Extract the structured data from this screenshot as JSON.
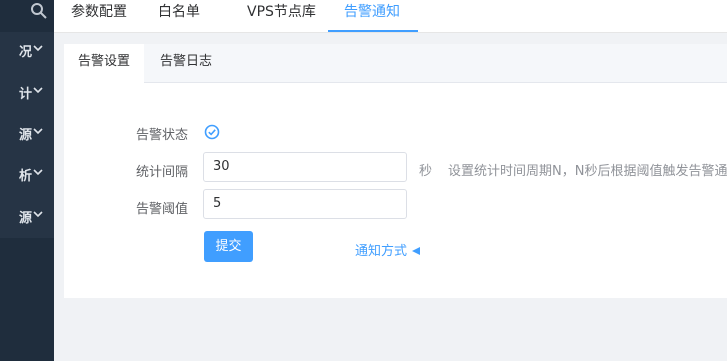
{
  "sidebar": {
    "items": [
      {
        "label": "况"
      },
      {
        "label": "计"
      },
      {
        "label": "源"
      },
      {
        "label": "析"
      },
      {
        "label": "源"
      }
    ]
  },
  "topnav": {
    "tabs": [
      {
        "label": "参数配置"
      },
      {
        "label": "白名单"
      },
      {
        "label": "VPS节点库"
      },
      {
        "label": "告警通知",
        "active": true
      }
    ]
  },
  "subtabs": [
    {
      "label": "告警设置",
      "active": true
    },
    {
      "label": "告警日志"
    }
  ],
  "form": {
    "status_label": "告警状态",
    "interval_label": "统计间隔",
    "interval_value": "30",
    "interval_unit": "秒",
    "interval_hint": "设置统计时间周期N，N秒后根据阈值触发告警通知",
    "threshold_label": "告警阈值",
    "threshold_value": "5",
    "submit_label": "提交",
    "notify_link": "通知方式"
  },
  "colors": {
    "accent": "#409eff",
    "sidebar_bg": "#1f2d3d",
    "sidebar_menu_bg": "#263445"
  }
}
